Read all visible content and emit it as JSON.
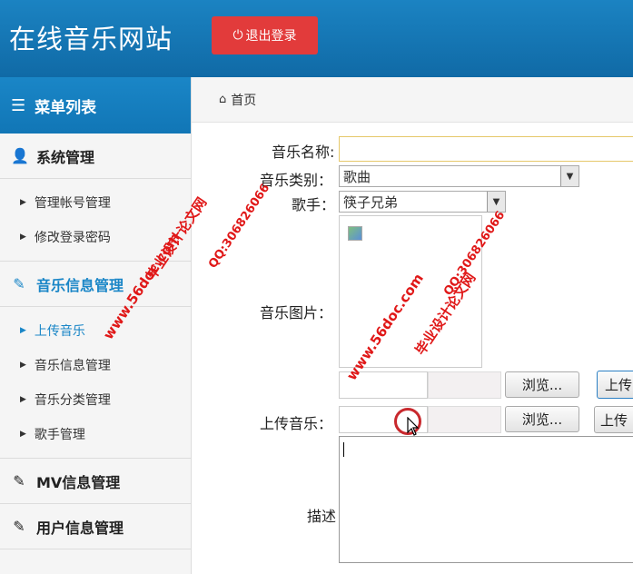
{
  "header": {
    "title": "在线音乐网站",
    "logout_label": "退出登录"
  },
  "sidebar": {
    "menu_title": "菜单列表",
    "sections": [
      {
        "label": "系统管理",
        "items": [
          "管理帐号管理",
          "修改登录密码"
        ]
      },
      {
        "label": "音乐信息管理",
        "items": [
          "上传音乐",
          "音乐信息管理",
          "音乐分类管理",
          "歌手管理"
        ]
      },
      {
        "label": "MV信息管理"
      },
      {
        "label": "用户信息管理"
      }
    ]
  },
  "breadcrumb": {
    "home": "首页"
  },
  "form": {
    "name_label": "音乐名称:",
    "name_value": "",
    "category_label": "音乐类别：",
    "category_value": "歌曲",
    "singer_label": "歌手：",
    "singer_value": "筷子兄弟",
    "image_label": "音乐图片：",
    "browse_label": "浏览...",
    "upload_label": "上传",
    "music_label": "上传音乐：",
    "desc_label": "描述"
  },
  "watermark": {
    "site": "www.56doc.com",
    "qq": "QQ:306826066",
    "name": "毕业设计论文网"
  },
  "colors": {
    "accent": "#1a86c7",
    "logout": "#e23b3b",
    "watermark": "#e01818"
  }
}
